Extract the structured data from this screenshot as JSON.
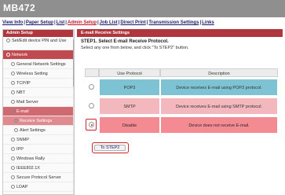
{
  "banner": {
    "title": "MB472"
  },
  "topnav": {
    "items": [
      {
        "label": "View Info",
        "active": false
      },
      {
        "label": "Paper Setup",
        "active": false
      },
      {
        "label": "List",
        "active": false
      },
      {
        "label": "Admin Setup",
        "active": true
      },
      {
        "label": "Job List",
        "active": false
      },
      {
        "label": "Direct Print",
        "active": false
      },
      {
        "label": "Transmission Settings",
        "active": false
      },
      {
        "label": "Links",
        "active": false
      }
    ],
    "separator": "|"
  },
  "sidebar": {
    "header": "Admin Setup",
    "items": [
      {
        "label": "Set/Edit device PIN and Use"
      },
      {
        "label": "Network"
      },
      {
        "label": "General Network Settings"
      },
      {
        "label": "Wireless Setting"
      },
      {
        "label": "TCP/IP"
      },
      {
        "label": "NBT"
      },
      {
        "label": "Mail Server"
      },
      {
        "label": "E-mail"
      },
      {
        "label": "Receive Settings"
      },
      {
        "label": "Alert Settings"
      },
      {
        "label": "SNMP"
      },
      {
        "label": "IPP"
      },
      {
        "label": "Windows Rally"
      },
      {
        "label": "IEEE802.1X"
      },
      {
        "label": "Secure Protocol Server"
      },
      {
        "label": "LDAP"
      }
    ]
  },
  "main": {
    "panel_title": "E-mail Receive Settings",
    "step_title": "STEP1. Select E-mail Receive Protocol.",
    "step_desc": "Select any one from below, and click \"To STEP2\" button.",
    "table": {
      "headers": {
        "protocol": "Use Protocol",
        "description": "Description"
      },
      "rows": [
        {
          "protocol": "POP3",
          "description": "Device receives E-mail using POP3 protocol.",
          "selected": false
        },
        {
          "protocol": "SMTP",
          "description": "Device receives E-mail using SMTP protocol.",
          "selected": false
        },
        {
          "protocol": "Disable",
          "description": "Device does not receive E-mail.",
          "selected": true
        }
      ]
    },
    "next_button": "To STEP2"
  },
  "colors": {
    "accent": "#b0363d",
    "pop3_row": "#7ec3d3",
    "smtp_row": "#f3b8bd",
    "disable_row": "#f48a92",
    "highlight": "#d0242f"
  }
}
